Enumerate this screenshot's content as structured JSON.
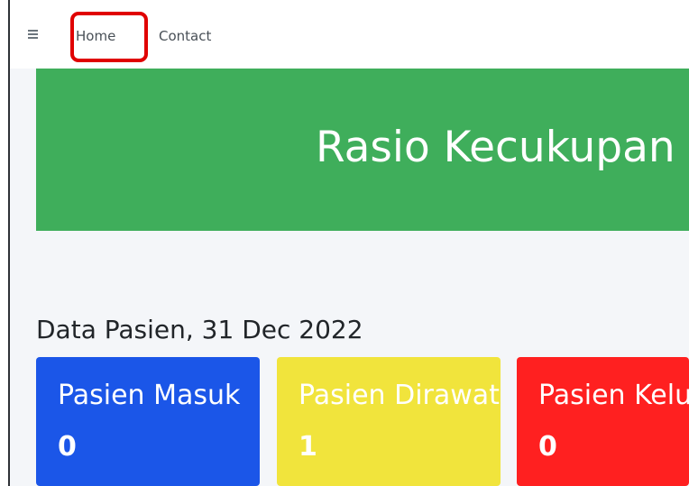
{
  "navbar": {
    "menu_icon": "hamburger-menu-icon",
    "links": [
      {
        "label": "Home"
      },
      {
        "label": "Contact"
      }
    ],
    "highlight_color": "#e00000"
  },
  "hero": {
    "title": "Rasio Kecukupan",
    "background_color": "#3fae5b"
  },
  "section": {
    "title": "Data Pasien, 31 Dec 2022"
  },
  "cards": [
    {
      "label": "Pasien Masuk",
      "value": "0",
      "color": "#1b56e8"
    },
    {
      "label": "Pasien Dirawat",
      "value": "1",
      "color": "#f1e43c"
    },
    {
      "label": "Pasien Keluar",
      "value": "0",
      "color": "#ff2020"
    }
  ]
}
